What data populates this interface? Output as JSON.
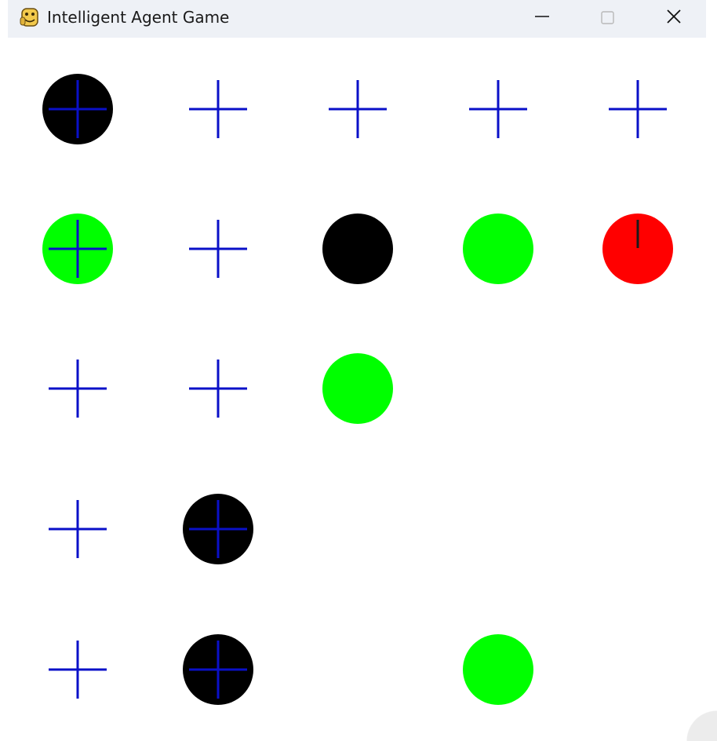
{
  "window": {
    "title": "Intelligent Agent Game",
    "icon": "python-snake-icon",
    "controls": [
      "minimize-icon",
      "maximize-icon",
      "close-icon"
    ]
  },
  "colors": {
    "cross": "#0a10c8",
    "pit": "#000000",
    "gold": "#00ff00",
    "agent": "#ff0000",
    "agent_marker": "#1a1a1a",
    "titlebar": "#eef1f6"
  },
  "board": {
    "rows": 5,
    "cols": 5,
    "cells": [
      [
        "pit+cross",
        "cross",
        "cross",
        "cross",
        "cross"
      ],
      [
        "gold+cross",
        "cross",
        "pit",
        "gold",
        "agent"
      ],
      [
        "cross",
        "cross",
        "gold",
        "empty",
        "empty"
      ],
      [
        "cross",
        "pit+cross",
        "empty",
        "empty",
        "empty"
      ],
      [
        "cross",
        "pit+cross",
        "empty",
        "gold",
        "empty"
      ]
    ]
  }
}
